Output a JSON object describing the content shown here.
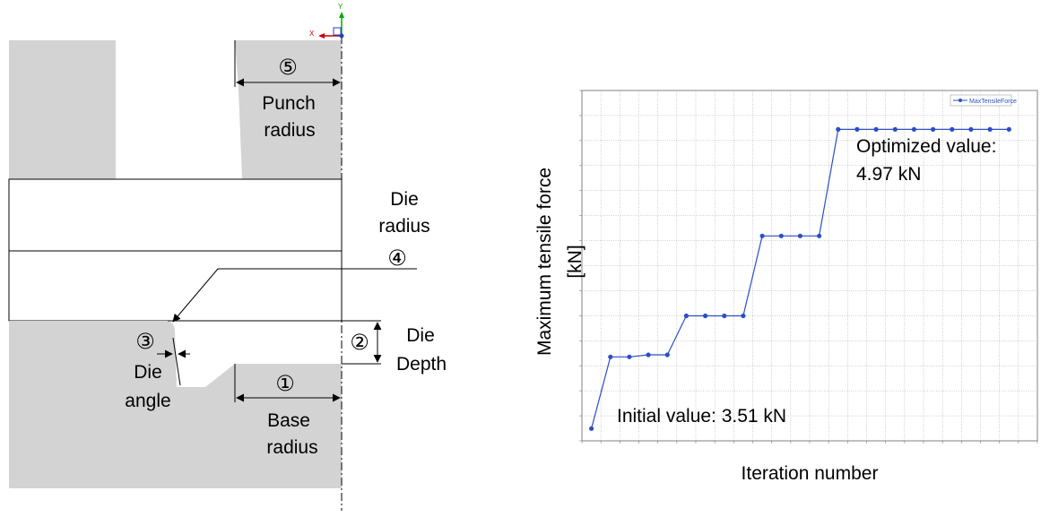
{
  "diagram": {
    "axis_labels": {
      "x": "X",
      "y": "Y"
    },
    "markers": {
      "m1": "①",
      "m2": "②",
      "m3": "③",
      "m4": "④",
      "m5": "⑤"
    },
    "labels": {
      "punch_radius_l1": "Punch",
      "punch_radius_l2": "radius",
      "die_radius_l1": "Die",
      "die_radius_l2": "radius",
      "die_depth_l1": "Die",
      "die_depth_l2": "Depth",
      "die_angle_l1": "Die",
      "die_angle_l2": "angle",
      "base_radius_l1": "Base",
      "base_radius_l2": "radius"
    },
    "colors": {
      "part_fill": "#d3d3d3",
      "line": "#000000",
      "axis_x": "#cc0000",
      "axis_y": "#00aa00",
      "origin": "#1f3fcf"
    }
  },
  "chart_data": {
    "type": "line",
    "title": "",
    "xlabel": "Iteration number",
    "ylabel_line1": "Maximum tensile force",
    "ylabel_line2": "[kN]",
    "xlim": [
      0,
      21
    ],
    "ylim": [
      3.45,
      5.16
    ],
    "grid": true,
    "legend_position": "top-right",
    "series": [
      {
        "name": "MaxTensileForce",
        "color": "#2a4fc4",
        "x": [
          1,
          2,
          3,
          4,
          5,
          6,
          7,
          8,
          9,
          10,
          11,
          12,
          13,
          14,
          15,
          16,
          17,
          18,
          19,
          20,
          21,
          22,
          23
        ],
        "values": [
          3.51,
          3.86,
          3.86,
          3.87,
          3.87,
          4.06,
          4.06,
          4.06,
          4.06,
          4.45,
          4.45,
          4.45,
          4.45,
          4.97,
          4.97,
          4.97,
          4.97,
          4.97,
          4.97,
          4.97,
          4.97,
          4.97,
          4.97
        ]
      }
    ],
    "annotations": {
      "optimized_l1": "Optimized value:",
      "optimized_l2": "4.97 kN",
      "initial": "Initial value: 3.51 kN"
    }
  }
}
